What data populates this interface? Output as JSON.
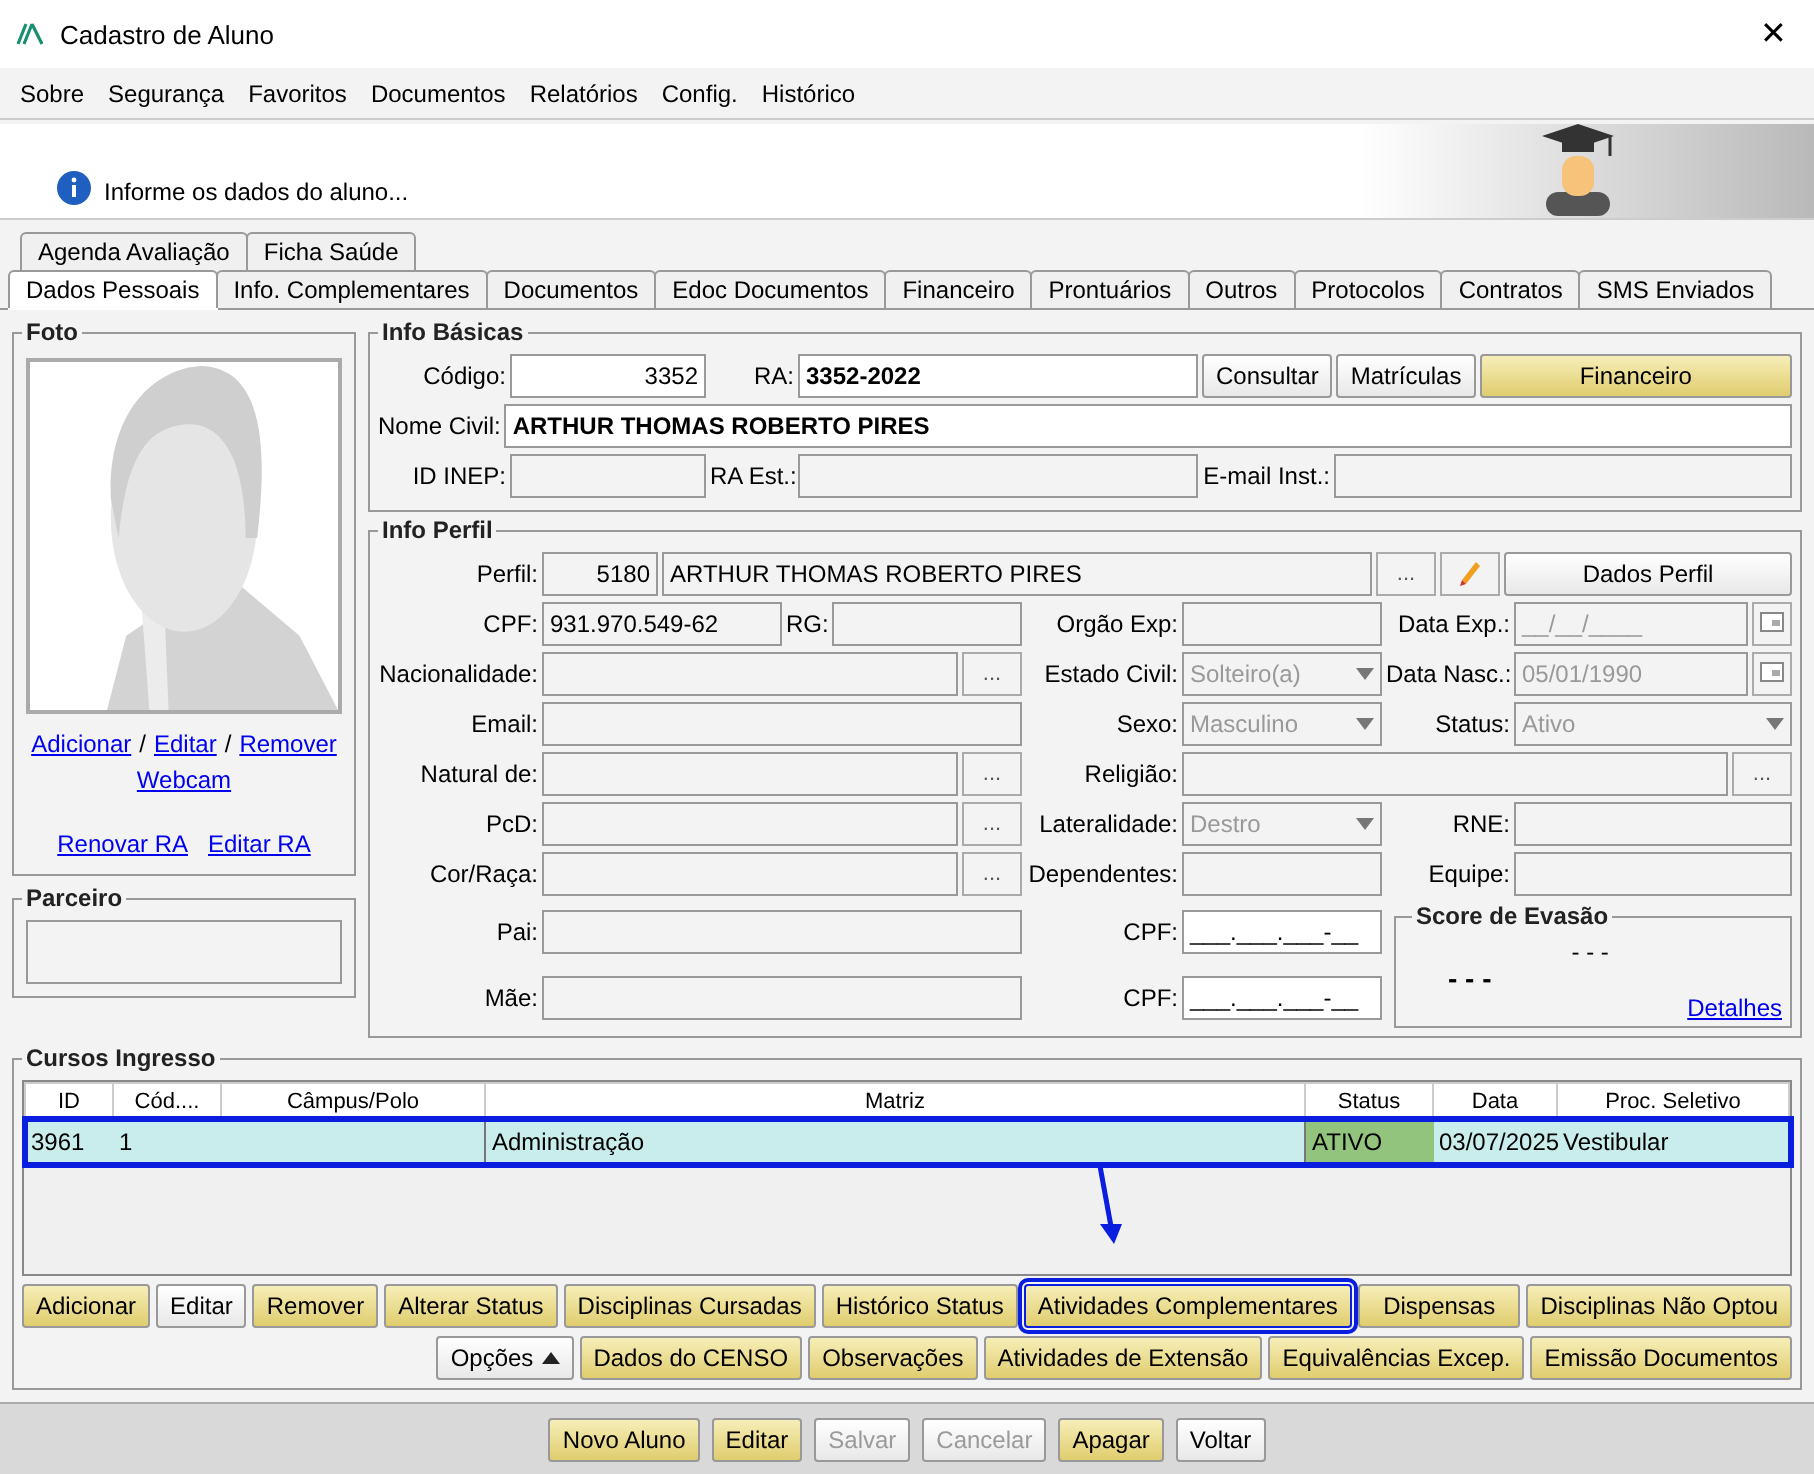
{
  "window": {
    "title": "Cadastro de Aluno",
    "close": "✕"
  },
  "menu": [
    {
      "label": "Sobre"
    },
    {
      "label": "Segurança"
    },
    {
      "label": "Favoritos"
    },
    {
      "label": "Documentos"
    },
    {
      "label": "Relatórios"
    },
    {
      "label": "Config."
    },
    {
      "label": "Histórico"
    }
  ],
  "banner": {
    "message": "Informe os dados do aluno..."
  },
  "tabs_row_1": [
    {
      "label": "Agenda Avaliação",
      "selected": false
    },
    {
      "label": "Ficha Saúde",
      "selected": false
    }
  ],
  "tabs_row_2": [
    {
      "label": "Dados Pessoais",
      "selected": true
    },
    {
      "label": "Info. Complementares",
      "selected": false
    },
    {
      "label": "Documentos",
      "selected": false
    },
    {
      "label": "Edoc Documentos",
      "selected": false
    },
    {
      "label": "Financeiro",
      "selected": false
    },
    {
      "label": "Prontuários",
      "selected": false
    },
    {
      "label": "Outros",
      "selected": false
    },
    {
      "label": "Protocolos",
      "selected": false
    },
    {
      "label": "Contratos",
      "selected": false
    },
    {
      "label": "SMS Enviados",
      "selected": false
    }
  ],
  "foto": {
    "title": "Foto",
    "photo_links": [
      "Adicionar",
      "Editar",
      "Remover"
    ],
    "separator": "/",
    "webcam": "Webcam",
    "ra_links": [
      "Renovar RA",
      "Editar RA"
    ]
  },
  "parceiro": {
    "title": "Parceiro"
  },
  "info_basicas": {
    "title": "Info Básicas",
    "codigo": {
      "label": "Código:",
      "value": "3352"
    },
    "ra": {
      "label": "RA:",
      "value": "3352-2022"
    },
    "buttons": [
      {
        "label": "Consultar",
        "kind": "plain"
      },
      {
        "label": "Matrículas",
        "kind": "plain"
      },
      {
        "label": "Financeiro",
        "kind": "gold"
      }
    ],
    "nome_civil": {
      "label": "Nome Civil:",
      "value": "ARTHUR THOMAS ROBERTO PIRES"
    },
    "id_inep": {
      "label": "ID INEP:"
    },
    "ra_est": {
      "label": "RA Est.:"
    },
    "email_inst": {
      "label": "E-mail Inst.:"
    }
  },
  "info_perfil": {
    "title": "Info Perfil",
    "perfil": {
      "label": "Perfil:",
      "code": "5180",
      "name": "ARTHUR THOMAS ROBERTO PIRES",
      "lookup": "...",
      "details_button": "Dados Perfil"
    },
    "rows": [
      [
        {
          "label": "CPF:",
          "kind": "pair",
          "value": "931.970.549-62",
          "second_label": "RG:"
        },
        {
          "label": "Orgão Exp:",
          "kind": "text"
        },
        {
          "label": "Data Exp.:",
          "kind": "date",
          "value": "__/__/____",
          "disabled": true
        }
      ],
      [
        {
          "label": "Nacionalidade:",
          "kind": "lookup",
          "button": "..."
        },
        {
          "label": "Estado Civil:",
          "kind": "select",
          "value": "Solteiro(a)",
          "disabled": true
        },
        {
          "label": "Data Nasc.:",
          "kind": "date",
          "value": "05/01/1990",
          "disabled": true
        }
      ],
      [
        {
          "label": "Email:",
          "kind": "text"
        },
        {
          "label": "Sexo:",
          "kind": "select",
          "value": "Masculino",
          "disabled": true
        },
        {
          "label": "Status:",
          "kind": "select",
          "value": "Ativo",
          "disabled": true
        }
      ],
      [
        {
          "label": "Natural de:",
          "kind": "lookup",
          "button": "..."
        },
        {
          "label": "Religião:",
          "kind": "lookup",
          "button": "..."
        }
      ],
      [
        {
          "label": "PcD:",
          "kind": "lookup",
          "button": "..."
        },
        {
          "label": "Lateralidade:",
          "kind": "select",
          "value": "Destro",
          "disabled": true
        },
        {
          "label": "RNE:",
          "kind": "text"
        }
      ],
      [
        {
          "label": "Cor/Raça:",
          "kind": "lookup",
          "button": "..."
        },
        {
          "label": "Dependentes:",
          "kind": "text"
        },
        {
          "label": "Equipe:",
          "kind": "text"
        }
      ]
    ],
    "parents": [
      {
        "label": "Pai:",
        "cpf_label": "CPF:",
        "cpf_value": "___.___.___-__"
      },
      {
        "label": "Mãe:",
        "cpf_label": "CPF:",
        "cpf_value": "___.___.___-__"
      }
    ],
    "score": {
      "title": "Score de Evasão",
      "value": "- - -",
      "secondary": "- - -",
      "link": "Detalhes"
    }
  },
  "cursos": {
    "title": "Cursos Ingresso",
    "columns": [
      {
        "label": "ID"
      },
      {
        "label": "Cód...."
      },
      {
        "label": "Câmpus/Polo"
      },
      {
        "label": "Matriz"
      },
      {
        "label": "Status",
        "kind": "status"
      },
      {
        "label": "Data"
      },
      {
        "label": "Proc. Seletivo"
      }
    ],
    "rows": [
      {
        "cells": [
          "3961",
          "1",
          "",
          "Administração",
          "ATIVO",
          "03/07/2025",
          "Vestibular"
        ],
        "selected": true,
        "highlighted": true,
        "active": true
      }
    ],
    "button_rows": [
      [
        {
          "label": "Adicionar",
          "kind": "gold"
        },
        {
          "label": "Editar",
          "kind": "plain"
        },
        {
          "label": "Remover",
          "kind": "gold"
        },
        {
          "label": "Alterar Status",
          "kind": "gold"
        },
        {
          "label": "Disciplinas Cursadas",
          "kind": "gold"
        },
        {
          "label": "Histórico Status",
          "kind": "gold"
        },
        {
          "label": "Atividades Complementares",
          "kind": "gold",
          "highlighted": true
        },
        {
          "label": "Dispensas",
          "kind": "gold"
        },
        {
          "label": "Disciplinas Não Optou",
          "kind": "gold"
        }
      ],
      [
        {
          "label": "Opções",
          "kind": "menu"
        },
        {
          "label": "Dados do CENSO",
          "kind": "gold"
        },
        {
          "label": "Observações",
          "kind": "gold"
        },
        {
          "label": "Atividades de Extensão",
          "kind": "gold"
        },
        {
          "label": "Equivalências Excep.",
          "kind": "gold"
        },
        {
          "label": "Emissão Documentos",
          "kind": "gold"
        }
      ]
    ]
  },
  "footer": [
    {
      "label": "Novo Aluno",
      "kind": "gold",
      "disabled": false
    },
    {
      "label": "Editar",
      "kind": "gold",
      "disabled": false
    },
    {
      "label": "Salvar",
      "kind": "plain",
      "disabled": true
    },
    {
      "label": "Cancelar",
      "kind": "plain",
      "disabled": true
    },
    {
      "label": "Apagar",
      "kind": "gold",
      "disabled": false
    },
    {
      "label": "Voltar",
      "kind": "plain",
      "disabled": false
    }
  ]
}
